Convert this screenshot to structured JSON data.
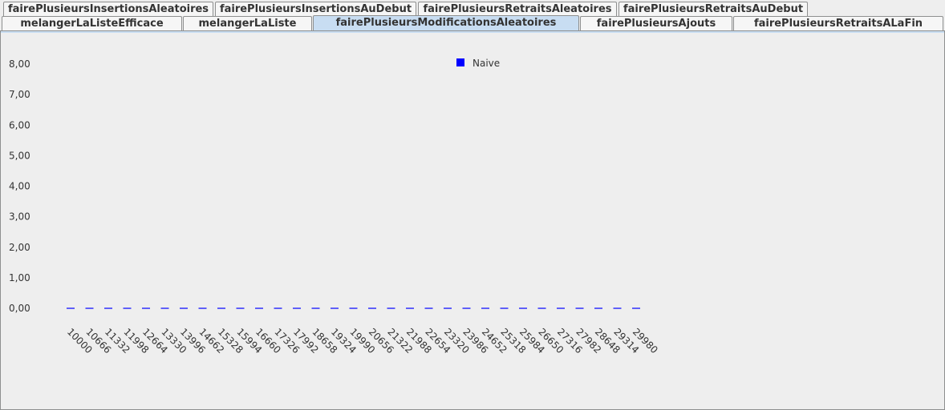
{
  "tabs": {
    "row1": [
      {
        "label": "fairePlusieursInsertionsAleatoires"
      },
      {
        "label": "fairePlusieursInsertionsAuDebut"
      },
      {
        "label": "fairePlusieursRetraitsAleatoires"
      },
      {
        "label": "fairePlusieursRetraitsAuDebut"
      }
    ],
    "row2": [
      {
        "label": "melangerLaListeEfficace"
      },
      {
        "label": "melangerLaListe"
      },
      {
        "label": "fairePlusieursModificationsAleatoires",
        "selected": true
      },
      {
        "label": "fairePlusieursAjouts"
      },
      {
        "label": "fairePlusieursRetraitsALaFin"
      }
    ]
  },
  "colors": {
    "series": "#0000ff",
    "selected_tab": "#c8ddf2"
  },
  "chart_data": {
    "type": "line",
    "title": "",
    "xlabel": "",
    "ylabel": "",
    "legend": "top-center",
    "ylim": [
      0,
      8
    ],
    "yticks": [
      "0,00",
      "1,00",
      "2,00",
      "3,00",
      "4,00",
      "5,00",
      "6,00",
      "7,00",
      "8,00"
    ],
    "x": [
      "10000",
      "10666",
      "11332",
      "11998",
      "12664",
      "13330",
      "13996",
      "14662",
      "15328",
      "15994",
      "16660",
      "17326",
      "17992",
      "18658",
      "19324",
      "19990",
      "20656",
      "21322",
      "21988",
      "22654",
      "23320",
      "23986",
      "24652",
      "25318",
      "25984",
      "26650",
      "27316",
      "27982",
      "28648",
      "29314",
      "29980"
    ],
    "series": [
      {
        "name": "Naive",
        "color": "#0000ff",
        "style": "dashed",
        "values": [
          0,
          0,
          0,
          0,
          0,
          0,
          0,
          0,
          0,
          0,
          0,
          0,
          0,
          0,
          0,
          0,
          0,
          0,
          0,
          0,
          0,
          0,
          0,
          0,
          0,
          0,
          0,
          0,
          0,
          0,
          0
        ]
      }
    ]
  }
}
